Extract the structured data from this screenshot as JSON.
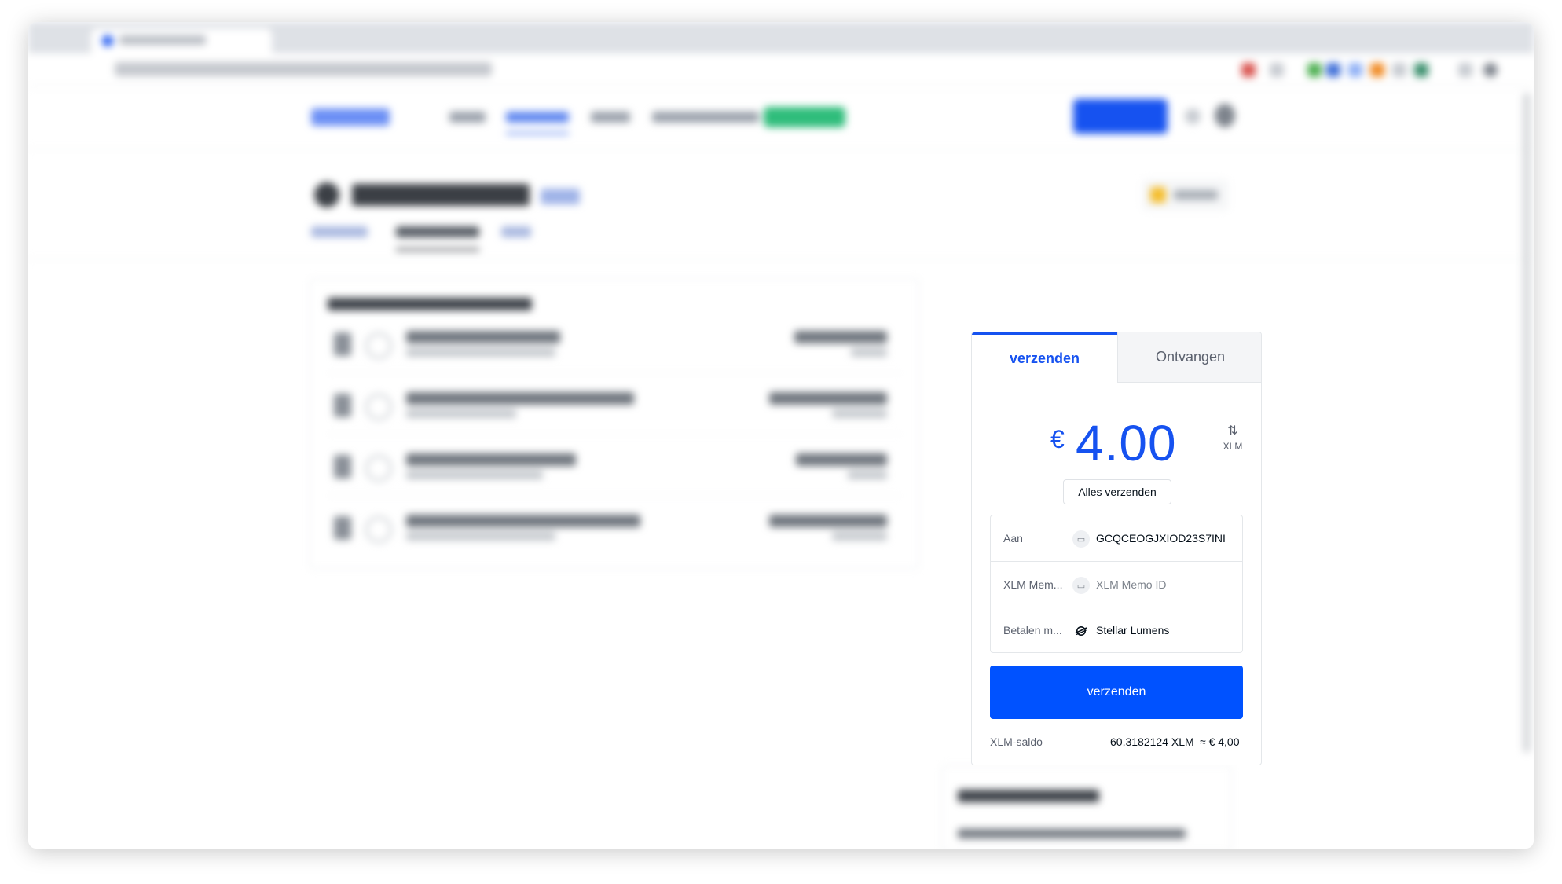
{
  "send_card": {
    "tabs": {
      "send_label": "verzenden",
      "receive_label": "Ontvangen"
    },
    "amount": {
      "currency_symbol": "€",
      "value": "4.00"
    },
    "switch": {
      "icon": "swap-vertical-icon",
      "label": "XLM"
    },
    "send_all_label": "Alles verzenden",
    "fields": {
      "to": {
        "label": "Aan",
        "icon": "address-book-icon",
        "value": "GCQCEOGJXIOD23S7INI"
      },
      "memo": {
        "label": "XLM Mem...",
        "icon": "memo-icon",
        "placeholder": "XLM Memo ID"
      },
      "pay_with": {
        "label": "Betalen m...",
        "icon": "stellar-icon",
        "value": "Stellar Lumens"
      }
    },
    "send_button_label": "verzenden",
    "balance": {
      "label": "XLM-saldo",
      "xlm_value": "60,3182124 XLM",
      "eur_value": "≈ € 4,00"
    }
  },
  "colors": {
    "accent": "#1652f0",
    "button": "#0052ff",
    "text": "#050f19",
    "muted": "#5b616e"
  }
}
